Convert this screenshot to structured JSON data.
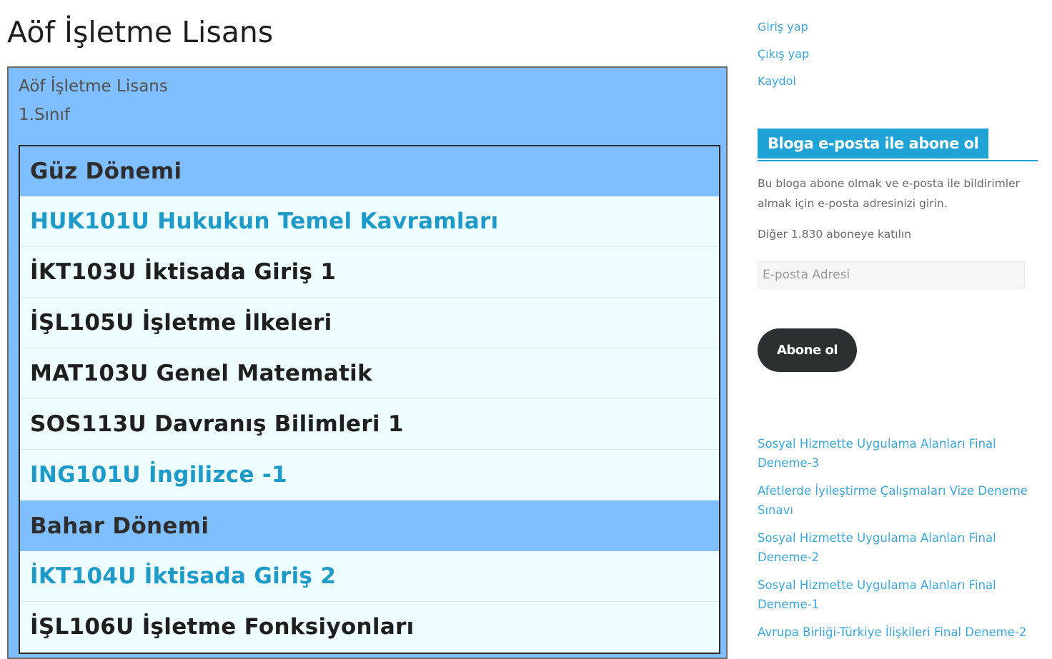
{
  "page": {
    "title": "Aöf İşletme Lisans"
  },
  "content": {
    "intro_title": "Aöf İşletme Lisans",
    "intro_class": "1.Sınıf",
    "rows": [
      {
        "text": "Güz Dönemi",
        "type": "header"
      },
      {
        "text": "HUK101U Hukukun Temel Kavramları",
        "type": "link"
      },
      {
        "text": "İKT103U İktisada Giriş 1",
        "type": "text"
      },
      {
        "text": "İŞL105U İşletme İlkeleri",
        "type": "text"
      },
      {
        "text": "MAT103U Genel Matematik",
        "type": "text"
      },
      {
        "text": "SOS113U Davranış Bilimleri 1",
        "type": "text"
      },
      {
        "text": "ING101U İngilizce -1",
        "type": "link"
      },
      {
        "text": "Bahar Dönemi",
        "type": "header"
      },
      {
        "text": "İKT104U İktisada Giriş 2",
        "type": "link"
      },
      {
        "text": "İŞL106U İşletme Fonksiyonları",
        "type": "text"
      }
    ]
  },
  "sidebar": {
    "meta_links": [
      "Giriş yap",
      "Çıkış yap",
      "Kaydol"
    ],
    "subscribe_widget": {
      "title": "Bloga e-posta ile abone ol",
      "description": "Bu bloga abone olmak ve e-posta ile bildirimler almak için e-posta adresinizi girin.",
      "subscriber_count": "Diğer 1.830 aboneye katılın",
      "email_placeholder": "E-posta Adresi",
      "button_label": "Abone ol"
    },
    "recent_posts": [
      "Sosyal Hizmette Uygulama Alanları Final Deneme-3",
      "Afetlerde İyileştirme Çalışmaları Vize Deneme Sınavı",
      "Sosyal Hizmette Uygulama Alanları Final Deneme-2",
      "Sosyal Hizmette Uygulama Alanları Final Deneme-1",
      "Avrupa Birliği-Türkiye İlişkileri Final Deneme-2"
    ]
  },
  "colors": {
    "box_background": "#80bfff",
    "row_background": "#eefdff",
    "link": "#1e9ac8",
    "widget_title_bg": "#1fa3d6",
    "button_bg": "#2b3032"
  }
}
